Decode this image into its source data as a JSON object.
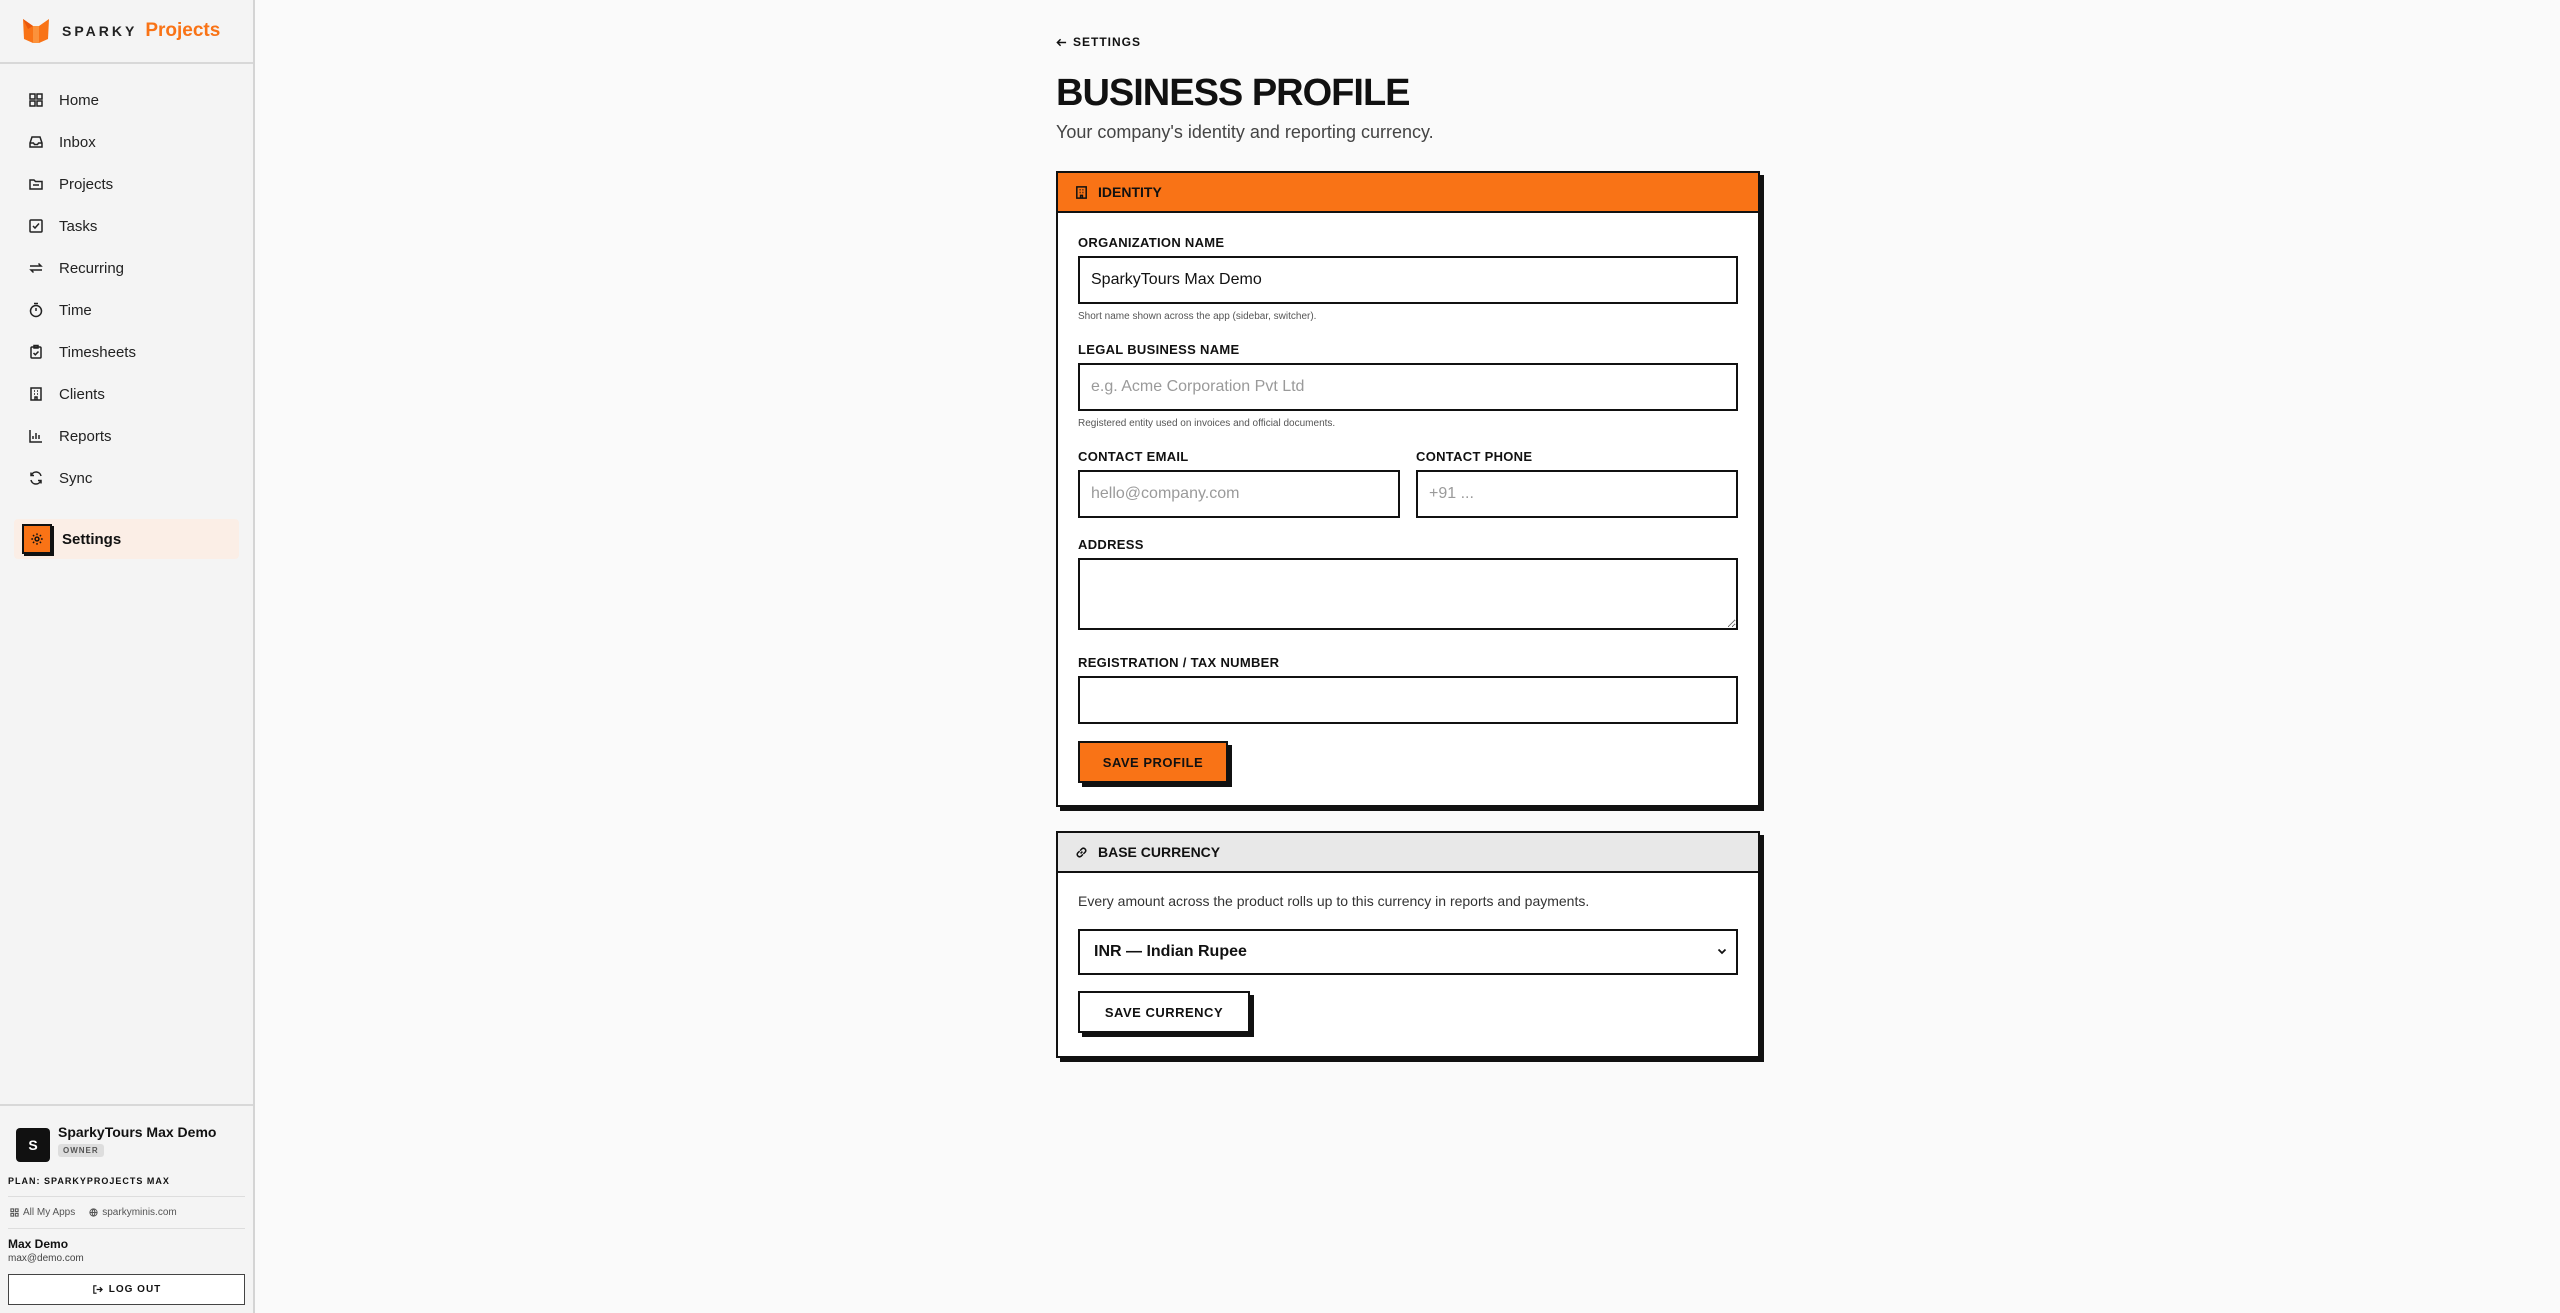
{
  "brand": {
    "word": "SPARKY",
    "product": "Projects",
    "accent": "#f97316"
  },
  "nav": {
    "items": [
      {
        "label": "Home",
        "icon": "home-icon"
      },
      {
        "label": "Inbox",
        "icon": "inbox-icon"
      },
      {
        "label": "Projects",
        "icon": "folder-icon"
      },
      {
        "label": "Tasks",
        "icon": "check-square-icon"
      },
      {
        "label": "Recurring",
        "icon": "repeat-icon"
      },
      {
        "label": "Time",
        "icon": "timer-icon"
      },
      {
        "label": "Timesheets",
        "icon": "clipboard-icon"
      },
      {
        "label": "Clients",
        "icon": "building-icon"
      },
      {
        "label": "Reports",
        "icon": "bar-chart-icon"
      },
      {
        "label": "Sync",
        "icon": "refresh-icon"
      }
    ],
    "active": {
      "label": "Settings",
      "icon": "gear-icon"
    }
  },
  "footer": {
    "org_initial": "S",
    "org_name": "SparkyTours Max Demo",
    "role_badge": "OWNER",
    "plan": "PLAN: SPARKYPROJECTS MAX",
    "link_apps": "All My Apps",
    "link_site": "sparkyminis.com",
    "user_name": "Max Demo",
    "user_email": "max@demo.com",
    "logout": "LOG OUT"
  },
  "page": {
    "back": "SETTINGS",
    "title": "BUSINESS PROFILE",
    "subtitle": "Your company's identity and reporting currency."
  },
  "identity": {
    "heading": "IDENTITY",
    "org_name_label": "ORGANIZATION NAME",
    "org_name_value": "SparkyTours Max Demo",
    "org_name_hint": "Short name shown across the app (sidebar, switcher).",
    "legal_label": "LEGAL BUSINESS NAME",
    "legal_placeholder": "e.g. Acme Corporation Pvt Ltd",
    "legal_hint": "Registered entity used on invoices and official documents.",
    "email_label": "CONTACT EMAIL",
    "email_placeholder": "hello@company.com",
    "phone_label": "CONTACT PHONE",
    "phone_placeholder": "+91 ...",
    "address_label": "ADDRESS",
    "address_value": "",
    "tax_label": "REGISTRATION / TAX NUMBER",
    "tax_value": "",
    "save": "SAVE PROFILE"
  },
  "currency": {
    "heading": "BASE CURRENCY",
    "description": "Every amount across the product rolls up to this currency in reports and payments.",
    "selected": "INR — Indian Rupee",
    "save": "SAVE CURRENCY"
  }
}
